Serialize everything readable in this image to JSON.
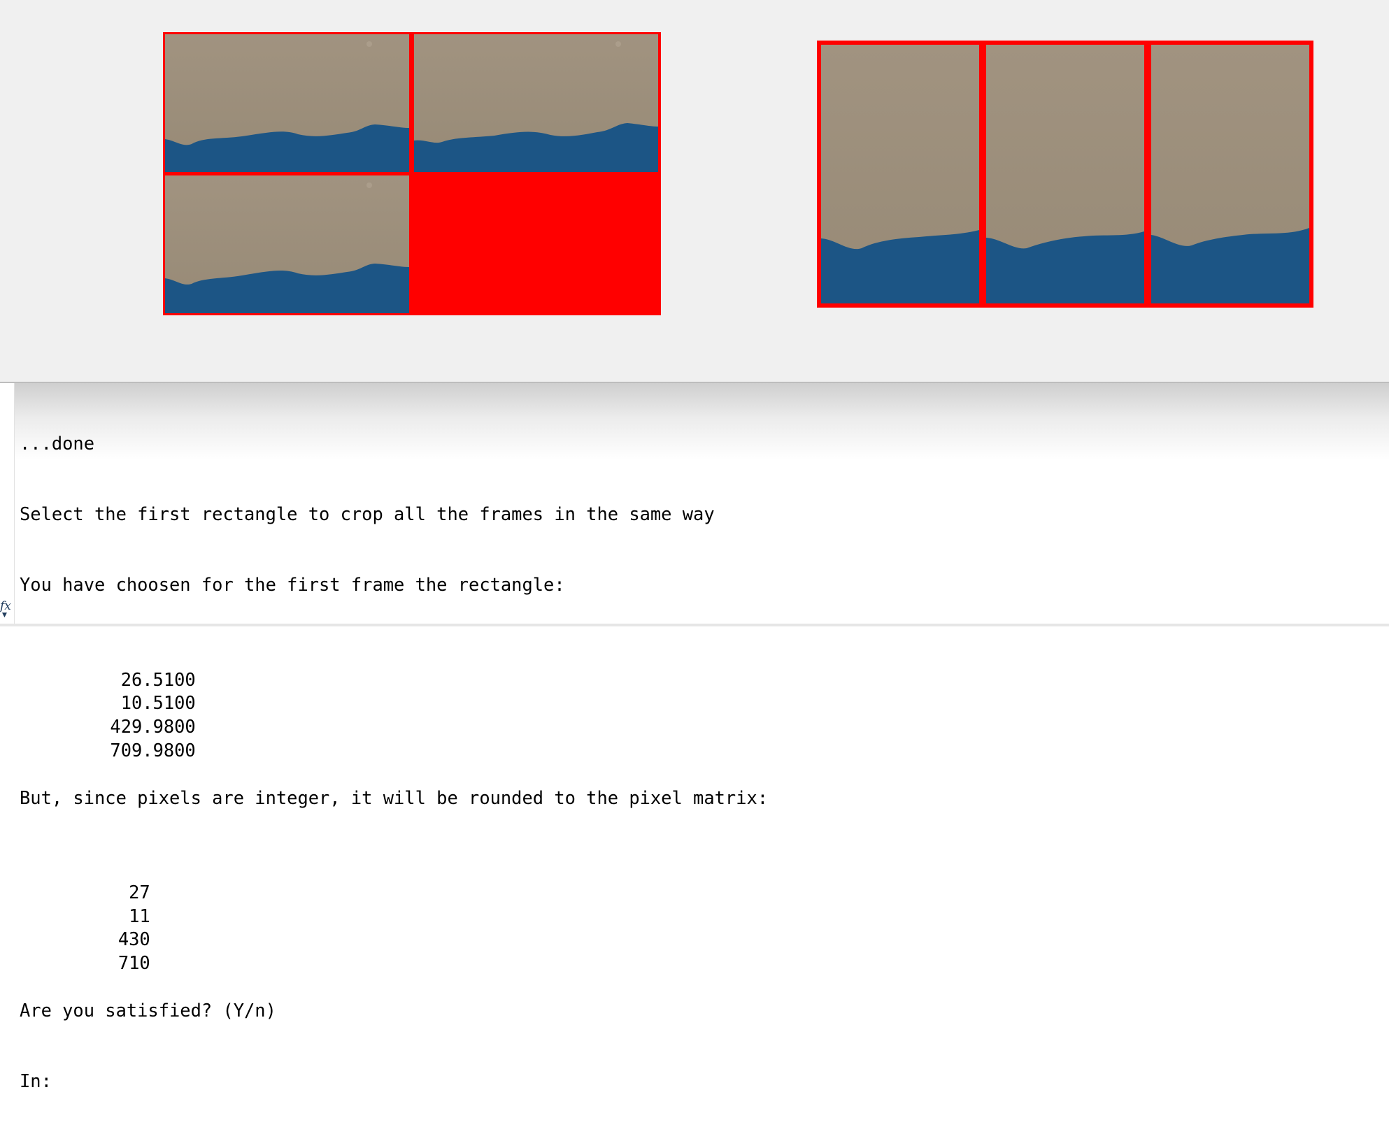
{
  "colors": {
    "figure_background": "#f0f0f0",
    "montage_border": "#ff0000",
    "sand": "#9c8e79",
    "water": "#1c5585",
    "console_text": "#000000"
  },
  "figure": {
    "left_montage": {
      "layout": "2x2",
      "frames": [
        "frame-1",
        "frame-2",
        "frame-3"
      ],
      "empty_cells": 1
    },
    "right_montage": {
      "layout": "1x3",
      "frames": [
        "frame-1-cropped",
        "frame-2-cropped",
        "frame-3-cropped"
      ]
    }
  },
  "console": {
    "lines": {
      "done": "...done",
      "select_prompt": "Select the first rectangle to crop all the frames in the same way",
      "chosen_intro": "You have choosen for the first frame the rectangle:",
      "rounded_intro": "But, since pixels are integer, it will be rounded to the pixel matrix:",
      "satisfied_prompt": "Are you satisfied? (Y/n)",
      "input_prompt": "In:"
    },
    "rectangle_values": [
      "26.5100",
      "10.5100",
      "429.9800",
      "709.9800"
    ],
    "rounded_values": [
      "27",
      "11",
      "430",
      "710"
    ],
    "icons": {
      "function_indicator": "fx-icon"
    }
  }
}
